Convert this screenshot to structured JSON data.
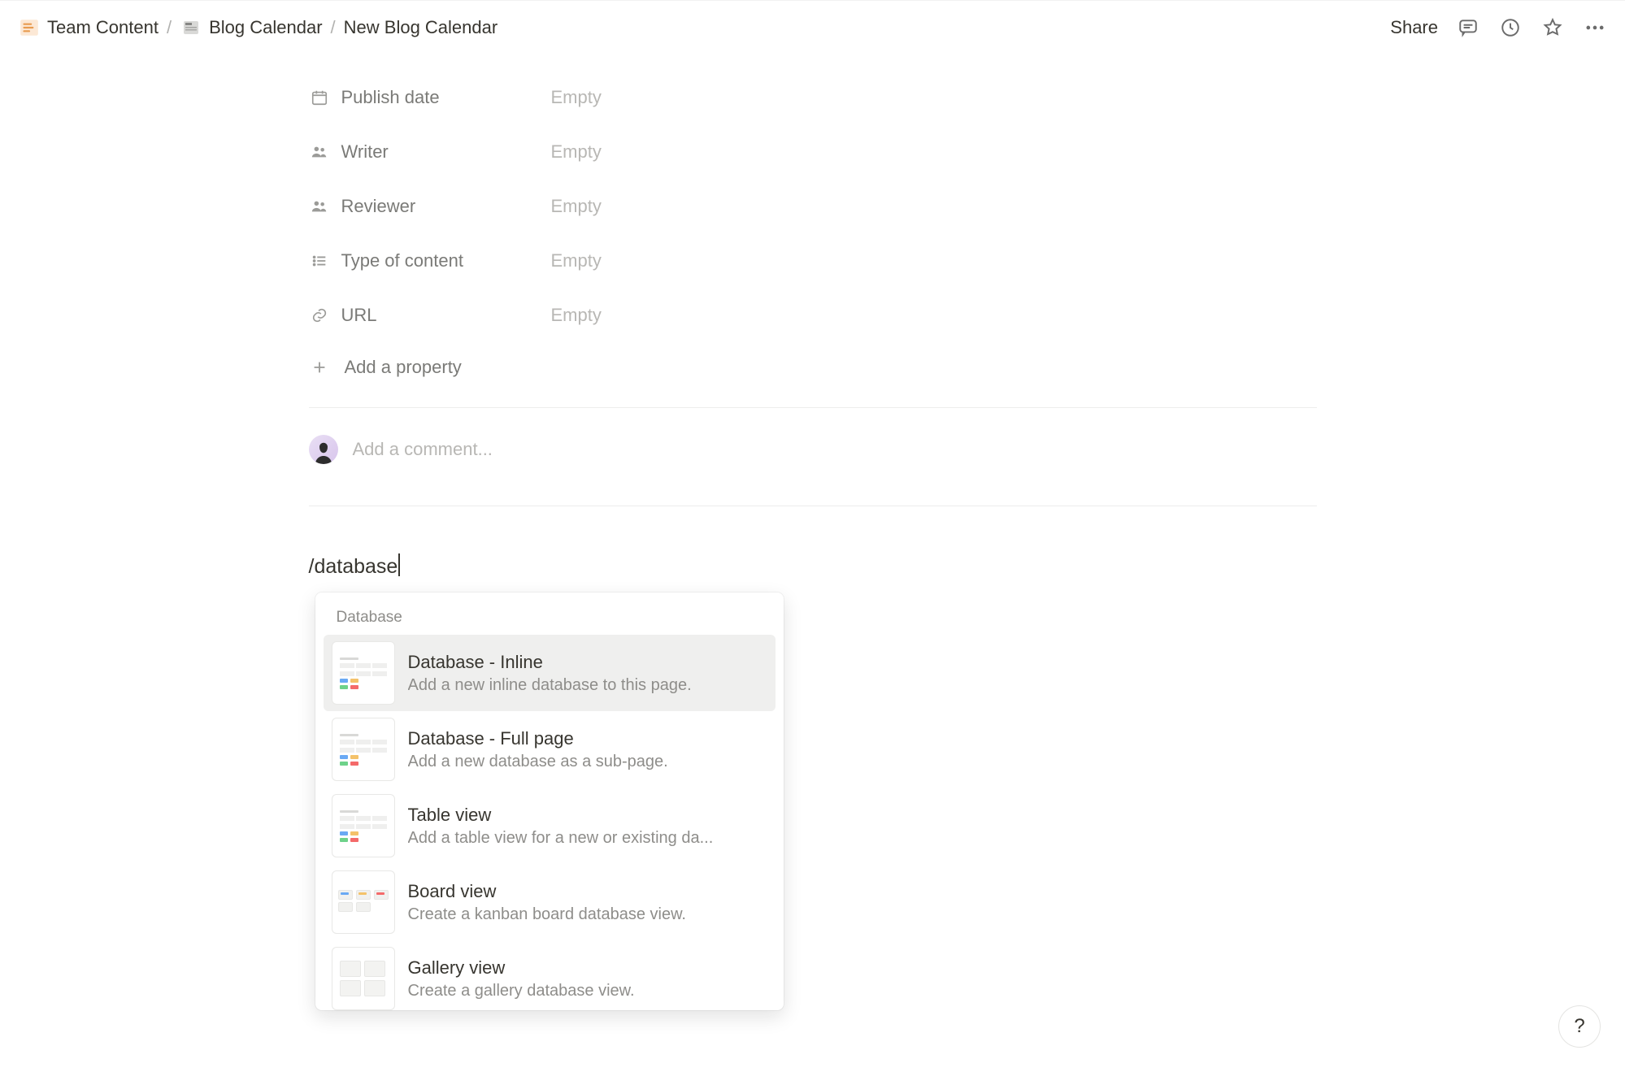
{
  "breadcrumb": {
    "items": [
      {
        "icon": "✍️",
        "label": "Team Content"
      },
      {
        "icon": "📰",
        "label": "Blog Calendar"
      },
      {
        "icon": "",
        "label": "New Blog Calendar"
      }
    ]
  },
  "topbar": {
    "share": "Share"
  },
  "properties": [
    {
      "icon": "calendar",
      "label": "Publish date",
      "value": "Empty"
    },
    {
      "icon": "people",
      "label": "Writer",
      "value": "Empty"
    },
    {
      "icon": "people",
      "label": "Reviewer",
      "value": "Empty"
    },
    {
      "icon": "list",
      "label": "Type of content",
      "value": "Empty"
    },
    {
      "icon": "link",
      "label": "URL",
      "value": "Empty"
    }
  ],
  "add_property": "Add a property",
  "comment_placeholder": "Add a comment...",
  "command_text": "/database",
  "menu": {
    "heading": "Database",
    "items": [
      {
        "title": "Database - Inline",
        "desc": "Add a new inline database to this page.",
        "thumb": "table"
      },
      {
        "title": "Database - Full page",
        "desc": "Add a new database as a sub-page.",
        "thumb": "table"
      },
      {
        "title": "Table view",
        "desc": "Add a table view for a new or existing da...",
        "thumb": "table"
      },
      {
        "title": "Board view",
        "desc": "Create a kanban board database view.",
        "thumb": "board"
      },
      {
        "title": "Gallery view",
        "desc": "Create a gallery database view.",
        "thumb": "gallery"
      }
    ]
  },
  "help": "?"
}
